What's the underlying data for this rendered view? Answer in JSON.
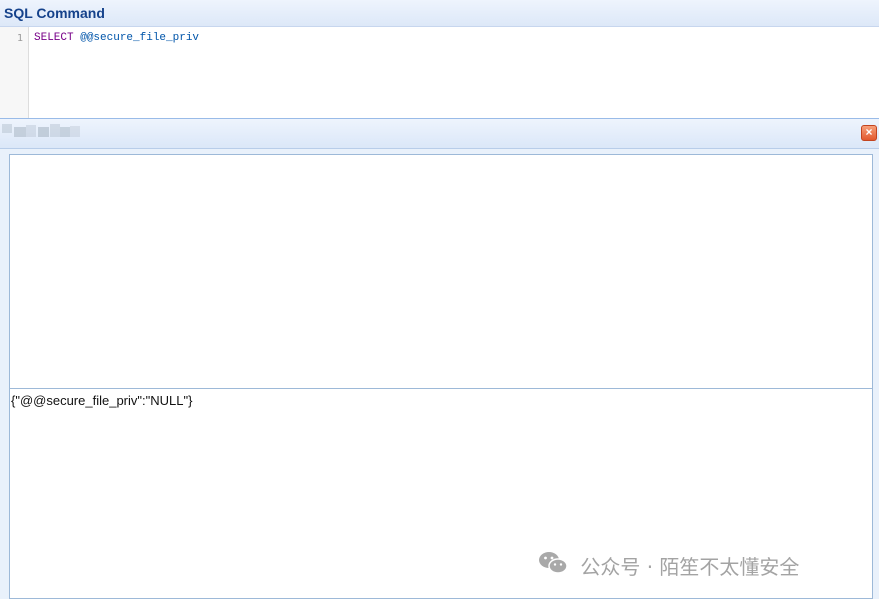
{
  "sql_panel": {
    "title": "SQL Command",
    "editor": {
      "line_number": "1",
      "keyword": "SELECT",
      "variable": "@@secure_file_priv"
    }
  },
  "result_panel": {
    "close_icon": "close-icon",
    "result_text": "{\"@@secure_file_priv\":\"NULL\"}"
  },
  "watermark": {
    "icon": "wechat-icon",
    "text": "公众号 · 陌笙不太懂安全"
  },
  "colors": {
    "title": "#15428b",
    "keyword": "#770088",
    "variable": "#0055aa",
    "close_button": "#e2582e"
  }
}
